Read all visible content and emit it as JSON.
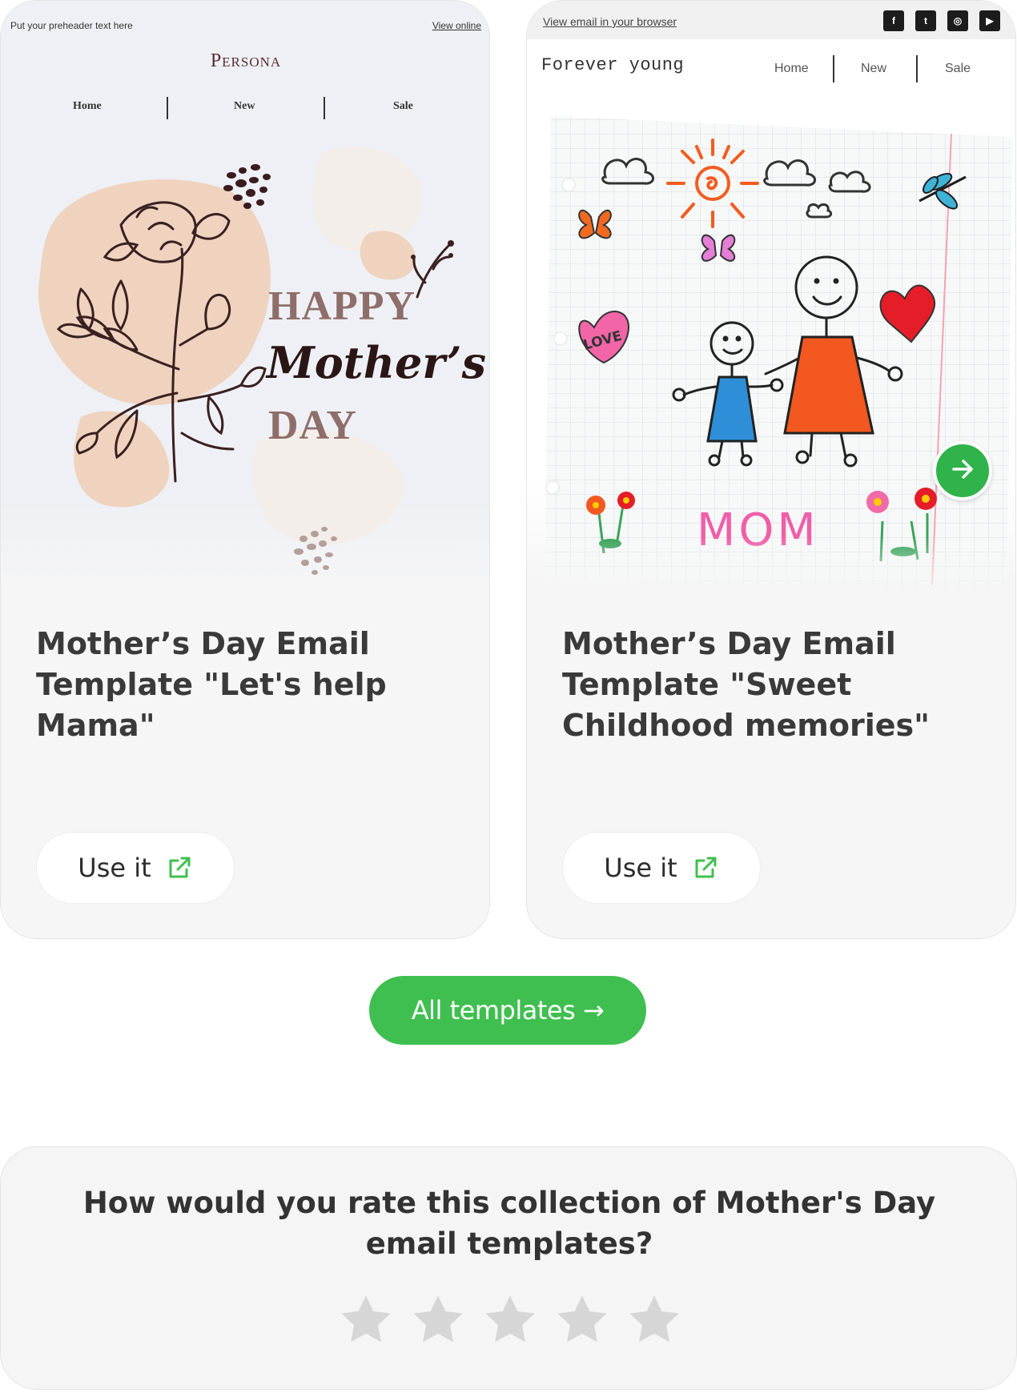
{
  "templates": [
    {
      "title": "Mother’s Day Email Template \"Let's help Mama\"",
      "use_label": "Use it",
      "preview": {
        "preheader": "Put your preheader text here",
        "view_online": "View online",
        "logo": "Persona",
        "nav": [
          "Home",
          "New",
          "Sale"
        ],
        "headline": {
          "line1": "HAPPY",
          "line2": "Mother’s",
          "line3": "DAY"
        }
      }
    },
    {
      "title": "Mother’s Day Email Template \"Sweet Childhood memories\"",
      "use_label": "Use it",
      "preview": {
        "view_browser": "View email in your browser",
        "social_icons": [
          "facebook-icon",
          "twitter-icon",
          "instagram-icon",
          "youtube-icon"
        ],
        "brand": "Forever young",
        "nav": [
          "Home",
          "New",
          "Sale"
        ],
        "drawing_texts": {
          "love": "LOVE",
          "mom": "MOM"
        }
      }
    }
  ],
  "all_templates_label": "All templates →",
  "rating": {
    "question": "How would you rate this collection of Mother's Day email templates?",
    "max_stars": 5,
    "current_rating": 0
  },
  "colors": {
    "accent_green": "#3fbf4f",
    "star_gray": "#d6d6d6",
    "card_bg": "#f6f6f6"
  }
}
